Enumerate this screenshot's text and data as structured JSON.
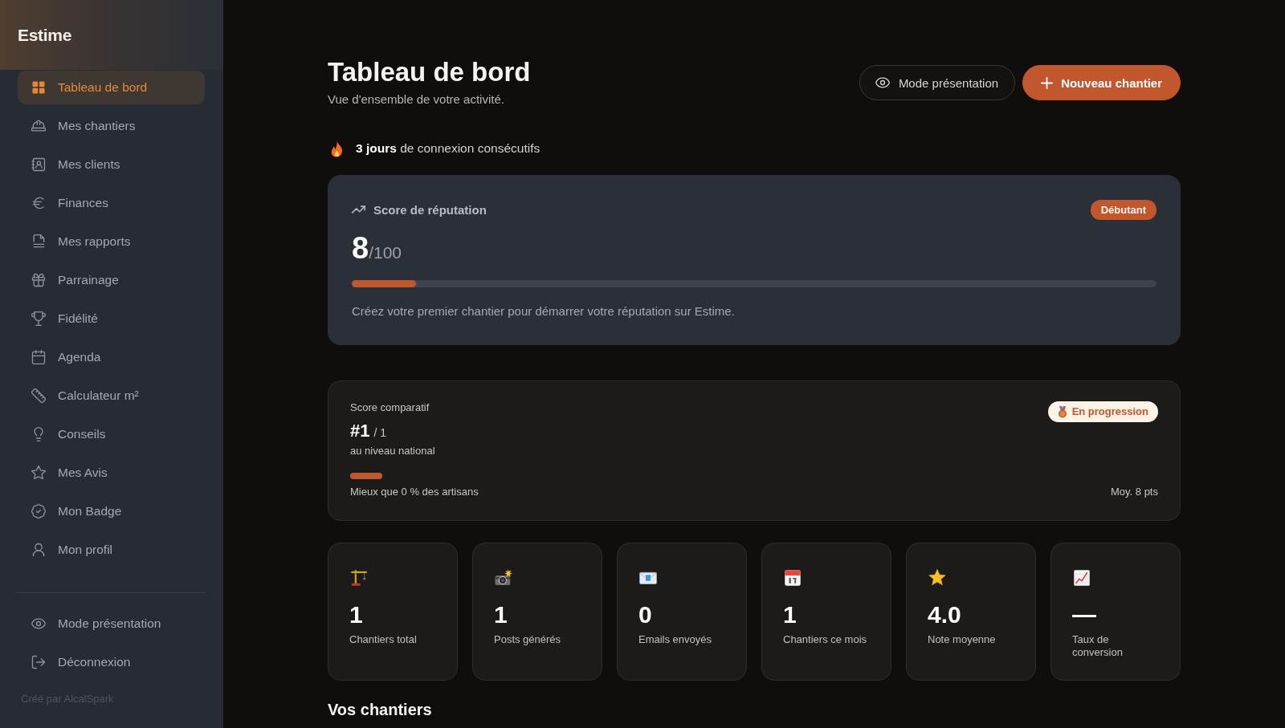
{
  "sidebar": {
    "logo": "Estime",
    "items": [
      {
        "label": "Tableau de bord",
        "selected": true
      },
      {
        "label": "Mes chantiers",
        "selected": false
      },
      {
        "label": "Mes clients",
        "selected": false
      },
      {
        "label": "Finances",
        "selected": false
      },
      {
        "label": "Mes rapports",
        "selected": false
      },
      {
        "label": "Parrainage",
        "selected": false
      },
      {
        "label": "Fidélité",
        "selected": false
      },
      {
        "label": "Agenda",
        "selected": false
      },
      {
        "label": "Calculateur m²",
        "selected": false
      },
      {
        "label": "Conseils",
        "selected": false
      },
      {
        "label": "Mes Avis",
        "selected": false
      },
      {
        "label": "Mon Badge",
        "selected": false
      },
      {
        "label": "Mon profil",
        "selected": false
      }
    ],
    "footer_items": [
      {
        "label": "Mode présentation"
      },
      {
        "label": "Déconnexion"
      }
    ],
    "credit": "Créé par AlcalSpark"
  },
  "header": {
    "title": "Tableau de bord",
    "subtitle": "Vue d'ensemble de votre activité.",
    "buttons": [
      {
        "label": "Mode présentation",
        "kind": "outline"
      },
      {
        "label": "Nouveau chantier",
        "kind": "primary"
      }
    ]
  },
  "streak": {
    "text": "**3 jours** de connexion consécutifs"
  },
  "reputation": {
    "title": "Score de réputation",
    "badge": "Débutant",
    "score": "8",
    "max": "/100",
    "level": 0.08,
    "message": "Créez votre premier chantier pour démarrer votre réputation sur Estime."
  },
  "comparative": {
    "title": "Score comparatif",
    "rank": "#1",
    "total": "/ 1",
    "scope": "au niveau national",
    "badge": "En progression",
    "level": 0,
    "percentile": "Mieux que 0 % des artisans",
    "average": "Moy. 8 pts"
  },
  "stats": [
    {
      "value": "1",
      "label": "Chantiers total"
    },
    {
      "value": "1",
      "label": "Posts générés"
    },
    {
      "value": "0",
      "label": "Emails envoyés"
    },
    {
      "value": "1",
      "label": "Chantiers ce mois"
    },
    {
      "value": "4.0",
      "label": "Note moyenne"
    },
    {
      "value": "—",
      "label": "Taux de conversion"
    }
  ],
  "section_title": "Vos chantiers"
}
